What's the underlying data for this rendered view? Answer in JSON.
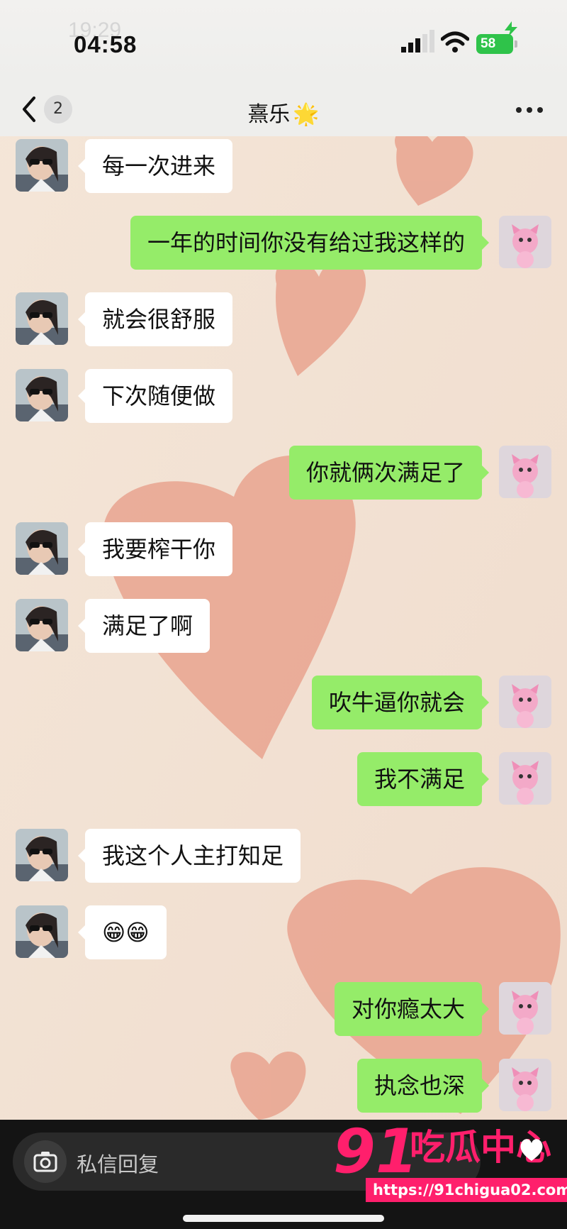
{
  "status": {
    "time": "04:58",
    "ghost_time": "19:29",
    "battery": "58"
  },
  "header": {
    "unread_count": "2",
    "contact_name": "熹乐",
    "name_emoji": "🌟"
  },
  "messages": [
    {
      "side": "left",
      "text": "每一次进来"
    },
    {
      "side": "right",
      "text": "一年的时间你没有给过我这样的"
    },
    {
      "side": "left",
      "text": "就会很舒服"
    },
    {
      "side": "left",
      "text": "下次随便做"
    },
    {
      "side": "right",
      "text": "你就俩次满足了"
    },
    {
      "side": "left",
      "text": "我要榨干你"
    },
    {
      "side": "left",
      "text": "满足了啊"
    },
    {
      "side": "right",
      "text": "吹牛逼你就会"
    },
    {
      "side": "right",
      "text": "我不满足"
    },
    {
      "side": "left",
      "text": "我这个人主打知足"
    },
    {
      "side": "left",
      "text": "😁😁"
    },
    {
      "side": "right",
      "text": "对你瘾太大"
    },
    {
      "side": "right",
      "text": "执念也深"
    }
  ],
  "input": {
    "placeholder": "私信回复"
  },
  "watermark": {
    "number": "91",
    "text": "吃瓜中心",
    "url": "https://91chigua02.com"
  },
  "colors": {
    "sent_bubble": "#95ec69",
    "received_bubble": "#ffffff",
    "watermark": "#ff1f6c"
  },
  "icons": [
    "back-chevron-icon",
    "more-icon",
    "camera-icon",
    "signal-icon",
    "wifi-icon",
    "battery-icon"
  ]
}
